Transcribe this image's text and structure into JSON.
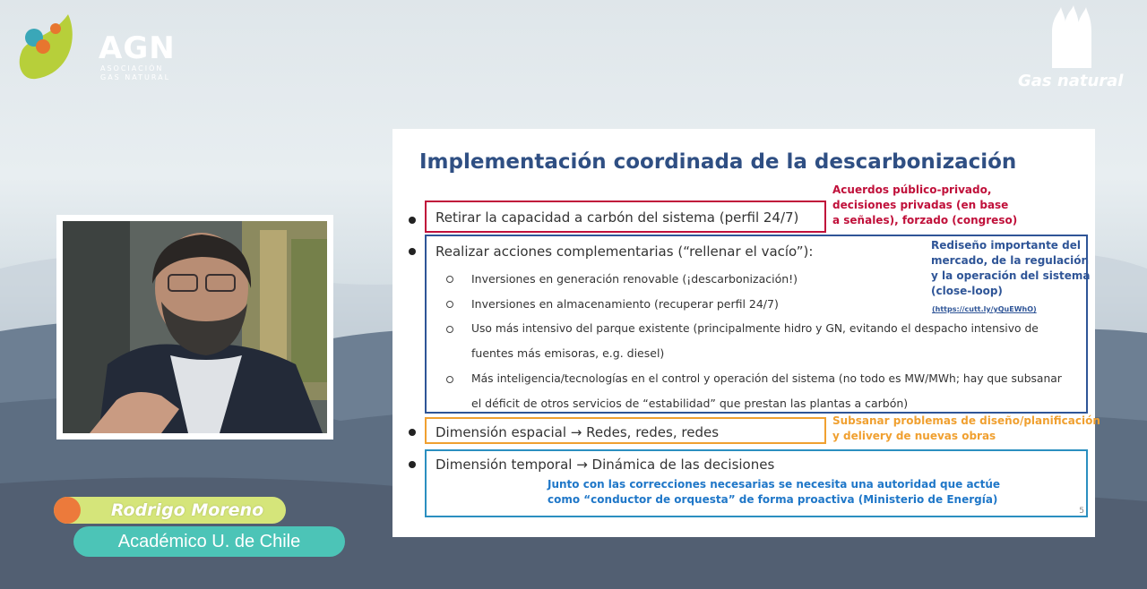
{
  "logos": {
    "agn_name": "AGN",
    "agn_sub": "ASOCIACIÓN GAS NATURAL",
    "gas_natural": "Gas natural"
  },
  "speaker": {
    "name": "Rodrigo Moreno",
    "role": "Académico U. de Chile"
  },
  "slide": {
    "title": "Implementación coordinada de la descarbonización",
    "page_number": "5",
    "bullet1": {
      "text": "Retirar la capacidad a carbón del sistema (perfil 24/7)",
      "note_lines": [
        "Acuerdos público-privado,",
        "decisiones privadas (en base",
        "a señales), forzado (congreso)"
      ]
    },
    "bullet2": {
      "text": "Realizar acciones complementarias (“rellenar el vacío”):",
      "sub": [
        "Inversiones en generación renovable (¡descarbonización!)",
        "Inversiones en almacenamiento (recuperar perfil 24/7)",
        "Uso más intensivo del parque existente (principalmente hidro y GN, evitando el despacho intensivo de",
        "fuentes más emisoras, e.g. diesel)",
        "Más inteligencia/tecnologías en el control y operación del sistema (no todo es MW/MWh; hay que subsanar",
        "el déficit de otros servicios de “estabilidad” que prestan las plantas a carbón)"
      ],
      "note_lines": [
        "Rediseño importante del",
        "mercado, de la regulación",
        "y la operación del sistema",
        "(close-loop)"
      ],
      "link": "(https://cutt.ly/yQuEWhO)"
    },
    "bullet3": {
      "text": "Dimensión espacial → Redes, redes, redes",
      "note_lines": [
        "Subsanar problemas de diseño/planificación",
        "y delivery de nuevas obras"
      ]
    },
    "bullet4": {
      "text": "Dimensión temporal → Dinámica de las decisiones",
      "note_lines": [
        "Junto con las correcciones necesarias se necesita una autoridad que actúe",
        "como “conductor de orquesta” de forma proactiva (Ministerio de Energía)"
      ]
    }
  },
  "colors": {
    "title": "#2f4f83",
    "red": "#c0103a",
    "blue": "#2f5597",
    "orange": "#f0a030",
    "cyan": "#2b8fc0",
    "name_pill": "#d5e57a",
    "role_pill": "#4cc4b7"
  }
}
